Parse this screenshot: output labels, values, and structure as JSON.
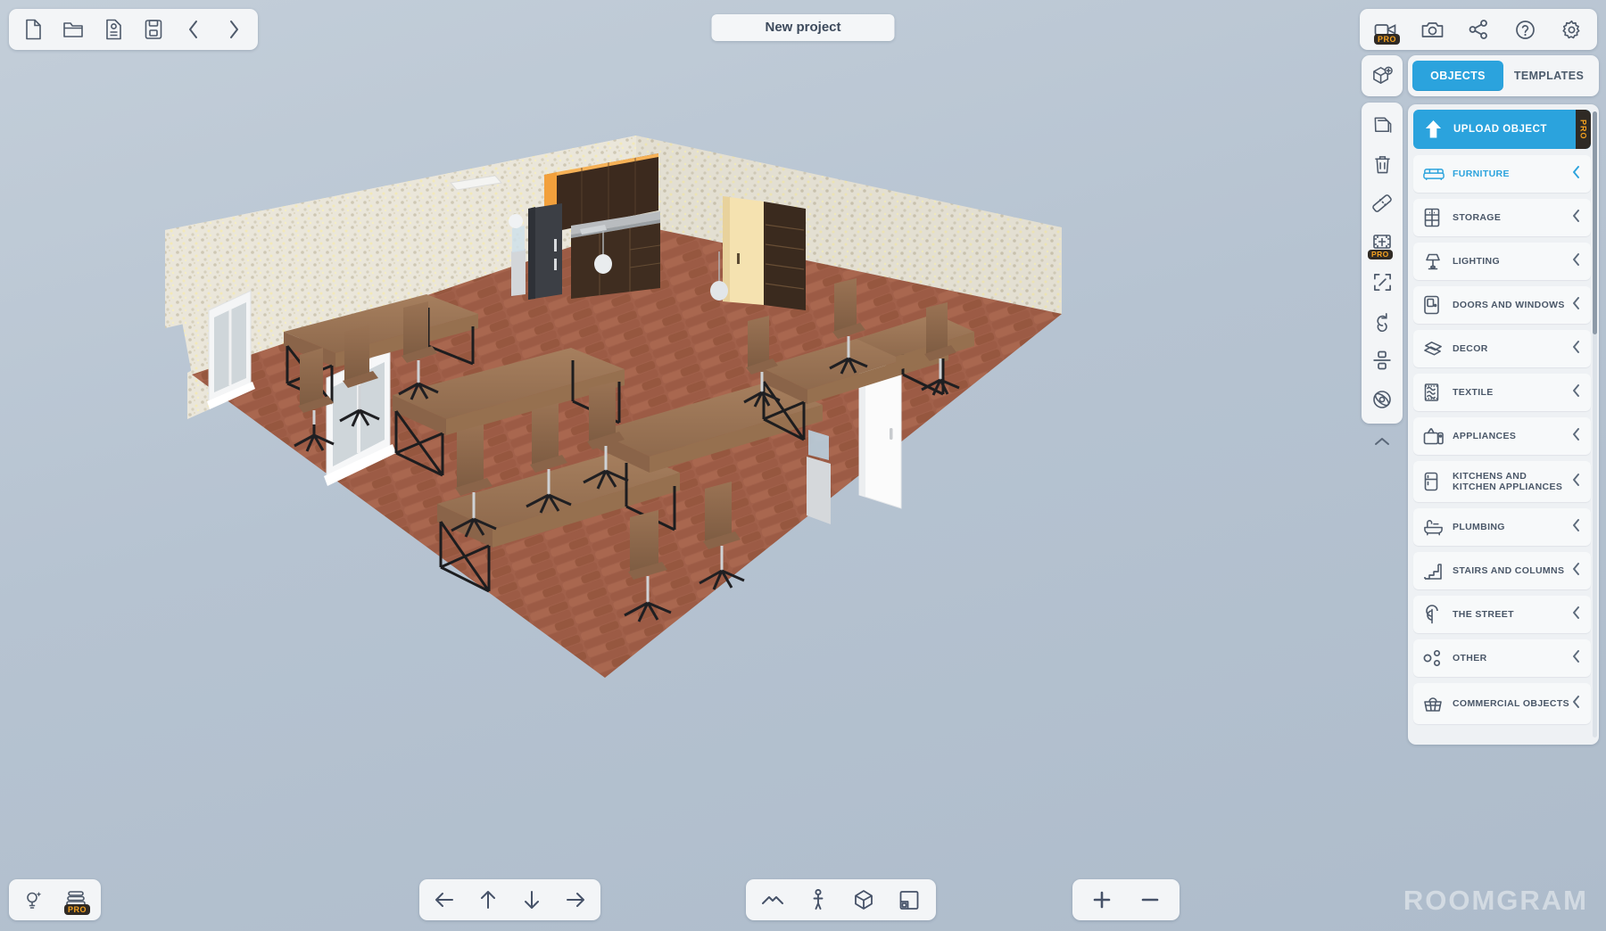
{
  "app": {
    "title": "New project",
    "watermark": "ROOMGRAM",
    "accent_color": "#2ba3dd",
    "pro_badge_text": "PRO",
    "background_color": "#b6c3d1"
  },
  "toolbar_left": {
    "items": [
      {
        "name": "new-project-icon",
        "label": "New project"
      },
      {
        "name": "open-project-icon",
        "label": "Open project"
      },
      {
        "name": "save-as-icon",
        "label": "Save as"
      },
      {
        "name": "save-icon",
        "label": "Save"
      },
      {
        "name": "undo-icon",
        "label": "Undo"
      },
      {
        "name": "redo-icon",
        "label": "Redo"
      }
    ]
  },
  "toolbar_topright": {
    "items": [
      {
        "name": "video-record-icon",
        "label": "Record video",
        "pro": true
      },
      {
        "name": "camera-icon",
        "label": "Screenshot",
        "pro": false
      },
      {
        "name": "share-icon",
        "label": "Share",
        "pro": false
      },
      {
        "name": "help-icon",
        "label": "Help",
        "pro": false
      },
      {
        "name": "settings-gear-icon",
        "label": "Settings",
        "pro": false
      }
    ]
  },
  "tool_rail": {
    "top_item": {
      "name": "add-object-icon",
      "label": "Add object"
    },
    "items": [
      {
        "name": "duplicate-icon",
        "label": "Duplicate",
        "pro": false
      },
      {
        "name": "delete-icon",
        "label": "Delete",
        "pro": false
      },
      {
        "name": "measure-icon",
        "label": "Measure",
        "pro": false
      },
      {
        "name": "move-object-icon",
        "label": "Move",
        "pro": true
      },
      {
        "name": "resize-icon",
        "label": "Resize",
        "pro": false
      },
      {
        "name": "rotate-icon",
        "label": "Rotate",
        "pro": false
      },
      {
        "name": "align-icon",
        "label": "Align",
        "pro": false
      },
      {
        "name": "materials-icon",
        "label": "Materials",
        "pro": false
      }
    ],
    "collapse": {
      "name": "collapse-rail-icon",
      "label": "Collapse"
    }
  },
  "right_panel": {
    "tabs": [
      {
        "label": "OBJECTS",
        "active": true
      },
      {
        "label": "TEMPLATES",
        "active": false
      }
    ],
    "upload": {
      "label": "UPLOAD OBJECT",
      "pro": true,
      "icon": "upload-arrow-icon"
    },
    "categories": [
      {
        "label": "FURNITURE",
        "icon": "sofa-icon",
        "highlight": true
      },
      {
        "label": "STORAGE",
        "icon": "cabinet-icon",
        "highlight": false
      },
      {
        "label": "LIGHTING",
        "icon": "lamp-icon",
        "highlight": false
      },
      {
        "label": "DOORS AND WINDOWS",
        "icon": "door-icon",
        "highlight": false
      },
      {
        "label": "DECOR",
        "icon": "decor-icon",
        "highlight": false
      },
      {
        "label": "TEXTILE",
        "icon": "textile-icon",
        "highlight": false
      },
      {
        "label": "APPLIANCES",
        "icon": "tv-icon",
        "highlight": false
      },
      {
        "label": "KITCHENS AND KITCHEN APPLIANCES",
        "icon": "fridge-icon",
        "highlight": false
      },
      {
        "label": "PLUMBING",
        "icon": "bathtub-icon",
        "highlight": false
      },
      {
        "label": "STAIRS AND COLUMNS",
        "icon": "stairs-icon",
        "highlight": false
      },
      {
        "label": "THE STREET",
        "icon": "tree-icon",
        "highlight": false
      },
      {
        "label": "OTHER",
        "icon": "other-dots-icon",
        "highlight": false
      },
      {
        "label": "COMMERCIAL OBJECTS",
        "icon": "basket-icon",
        "highlight": false
      }
    ],
    "chevron_glyph": "‹"
  },
  "bottom_left": {
    "items": [
      {
        "name": "light-settings-icon",
        "label": "Lighting",
        "pro": false
      },
      {
        "name": "floors-icon",
        "label": "Floors",
        "pro": true
      }
    ]
  },
  "nav_pad": {
    "items": [
      {
        "name": "pan-left-icon",
        "label": "Pan left",
        "glyph": "←"
      },
      {
        "name": "pan-up-icon",
        "label": "Pan up",
        "glyph": "↑"
      },
      {
        "name": "pan-down-icon",
        "label": "Pan down",
        "glyph": "↓"
      },
      {
        "name": "pan-right-icon",
        "label": "Pan right",
        "glyph": "→"
      }
    ]
  },
  "view_modes": {
    "items": [
      {
        "name": "roof-view-icon",
        "label": "Roof view"
      },
      {
        "name": "walkthrough-icon",
        "label": "Walkthrough"
      },
      {
        "name": "3d-view-icon",
        "label": "3D view"
      },
      {
        "name": "2d-plan-icon",
        "label": "2D plan"
      }
    ]
  },
  "zoom_controls": {
    "zoom_in": {
      "name": "zoom-in-button",
      "glyph": "+",
      "label": "Zoom in"
    },
    "zoom_out": {
      "name": "zoom-out-button",
      "glyph": "−",
      "label": "Zoom out"
    }
  },
  "scene": {
    "description": "3D isometric office room",
    "wall_color": "#e8e4d8",
    "floor_color": "#9e5d48",
    "objects": [
      "desks",
      "office-chairs",
      "windows",
      "door",
      "kitchen-cabinets",
      "refrigerator",
      "water-cooler",
      "wardrobe",
      "bookshelf",
      "pendant-lamps",
      "ceiling-light"
    ]
  }
}
